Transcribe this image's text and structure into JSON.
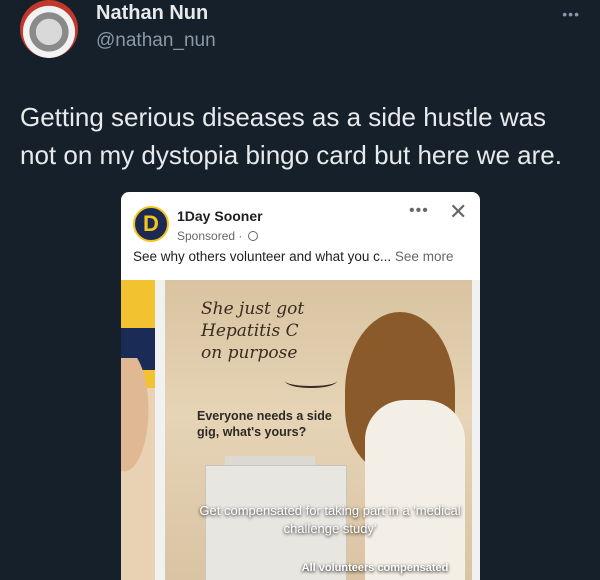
{
  "tweet": {
    "author_name": "Nathan Nun",
    "author_handle": "@nathan_nun",
    "more_glyph": "•••",
    "text": "Getting serious diseases as a side hustle was not on my dystopia bingo card but here we are."
  },
  "ad": {
    "logo_letter": "D",
    "advertiser": "1Day Sooner",
    "sponsored": "Sponsored ·",
    "description": "See why others volunteer and what you c...",
    "see_more": "See more",
    "dots_glyph": "•••",
    "close_glyph": "✕",
    "image": {
      "handwritten": "She just got\nHepatitis C\non purpose",
      "side_gig": "Everyone needs a side gig, what's yours?",
      "compensated": "Get compensated for taking part in a 'medical challenge study'",
      "volunteers": "All volunteers compensated"
    }
  }
}
